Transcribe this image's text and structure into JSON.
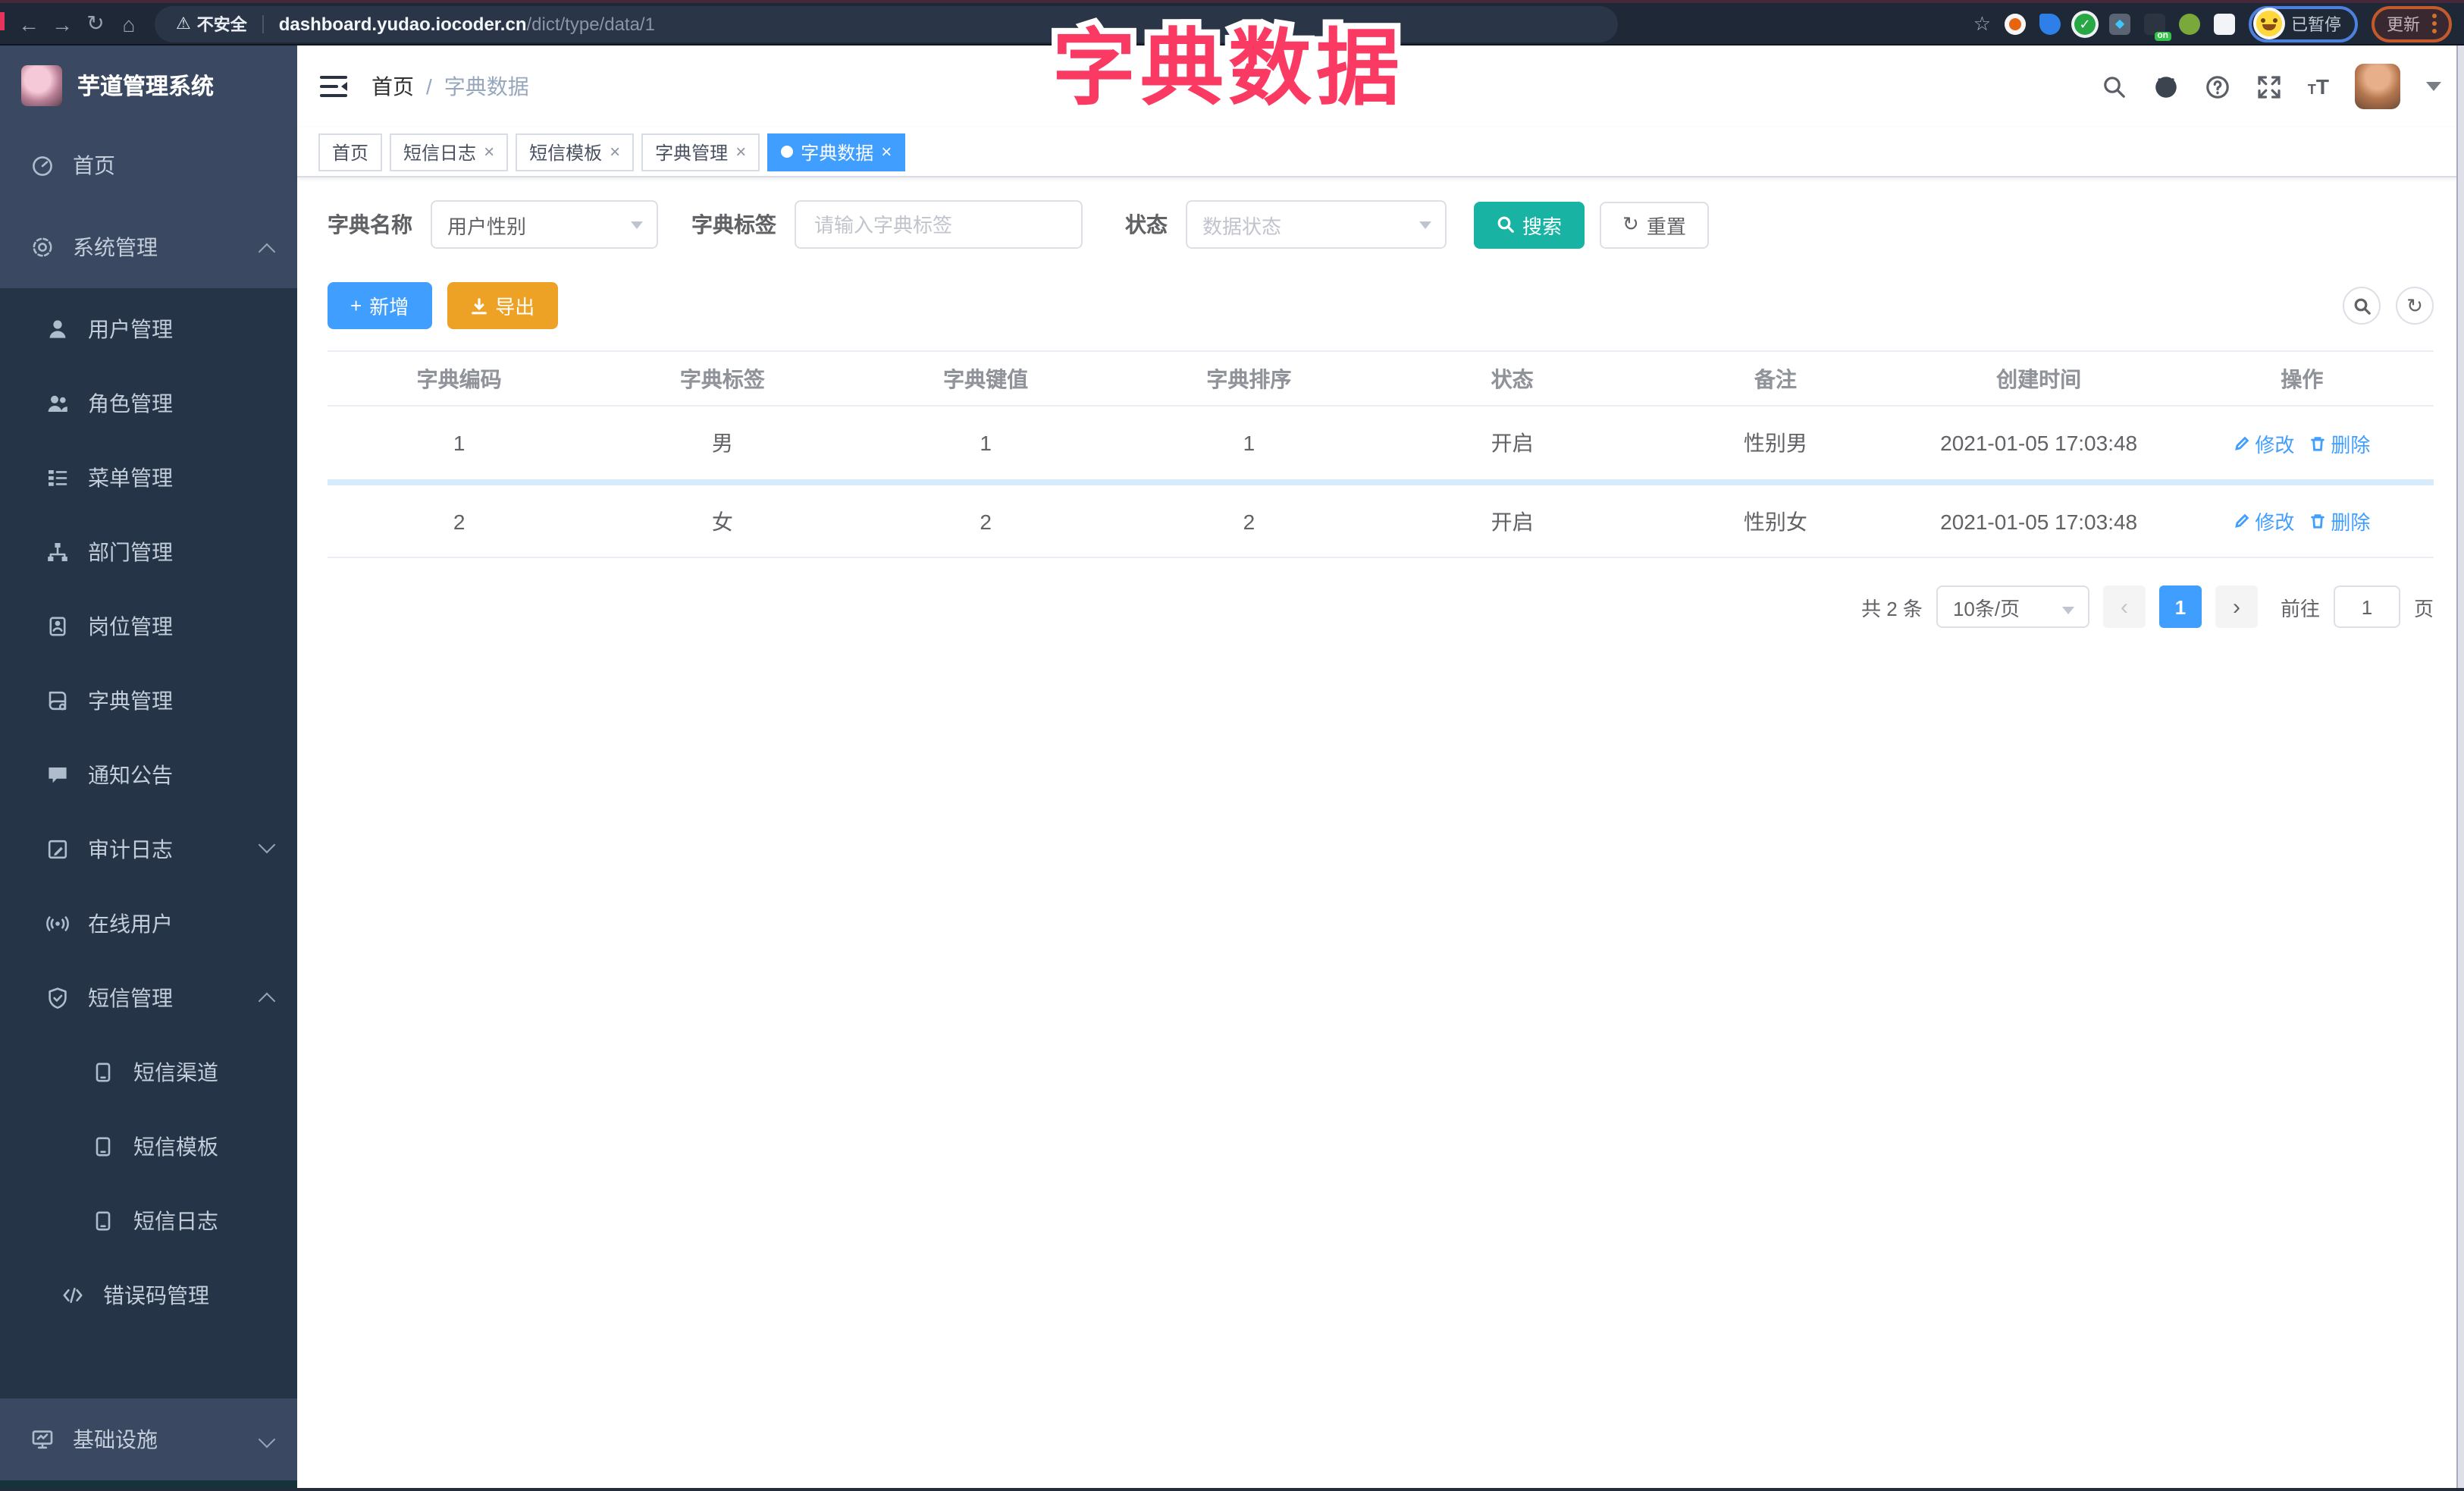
{
  "colors": {
    "primary": "#409eff",
    "search_teal": "#18b3a3",
    "export_warning": "#eda225",
    "overlay_pink": "#fa3a62",
    "sidebar_light": "#3a4961",
    "sidebar_dark": "#253447"
  },
  "overlay": {
    "title": "字典数据"
  },
  "chrome": {
    "security_label": "不安全",
    "url_host": "dashboard.yudao.iocoder.cn",
    "url_path": "/dict/type/data/1",
    "ext_badge": "on",
    "profile_status": "已暂停",
    "update_label": "更新"
  },
  "sidebar": {
    "app_title": "芋道管理系统",
    "items": [
      {
        "label": "首页",
        "icon": "dashboard-icon",
        "level": 1
      },
      {
        "label": "系统管理",
        "icon": "gear-icon",
        "level": 1,
        "expanded": true
      },
      {
        "label": "用户管理",
        "icon": "user-icon",
        "level": 2
      },
      {
        "label": "角色管理",
        "icon": "users-icon",
        "level": 2
      },
      {
        "label": "菜单管理",
        "icon": "menu-list-icon",
        "level": 2
      },
      {
        "label": "部门管理",
        "icon": "org-tree-icon",
        "level": 2
      },
      {
        "label": "岗位管理",
        "icon": "badge-icon",
        "level": 2
      },
      {
        "label": "字典管理",
        "icon": "dict-book-icon",
        "level": 2
      },
      {
        "label": "通知公告",
        "icon": "message-icon",
        "level": 2
      },
      {
        "label": "审计日志",
        "icon": "log-edit-icon",
        "level": 2,
        "expanded": false
      },
      {
        "label": "在线用户",
        "icon": "online-icon",
        "level": 2
      },
      {
        "label": "短信管理",
        "icon": "shield-check-icon",
        "level": 2,
        "expanded": true
      },
      {
        "label": "短信渠道",
        "icon": "phone-icon",
        "level": 3
      },
      {
        "label": "短信模板",
        "icon": "phone-icon",
        "level": 3
      },
      {
        "label": "短信日志",
        "icon": "phone-icon",
        "level": 3
      },
      {
        "label": "错误码管理",
        "icon": "code-icon",
        "level": 2
      },
      {
        "label": "基础设施",
        "icon": "monitor-icon",
        "level": 1,
        "expanded": false
      }
    ]
  },
  "navbar": {
    "breadcrumb_home": "首页",
    "breadcrumb_sep": "/",
    "breadcrumb_current": "字典数据"
  },
  "tabs": [
    {
      "label": "首页",
      "closable": false,
      "active": false
    },
    {
      "label": "短信日志",
      "closable": true,
      "active": false
    },
    {
      "label": "短信模板",
      "closable": true,
      "active": false
    },
    {
      "label": "字典管理",
      "closable": true,
      "active": false
    },
    {
      "label": "字典数据",
      "closable": true,
      "active": true
    }
  ],
  "filters": {
    "name_label": "字典名称",
    "name_value": "用户性别",
    "tag_label": "字典标签",
    "tag_placeholder": "请输入字典标签",
    "status_label": "状态",
    "status_placeholder": "数据状态",
    "search_label": "搜索",
    "reset_label": "重置"
  },
  "toolbar": {
    "add_label": "新增",
    "export_label": "导出"
  },
  "table": {
    "headers": [
      "字典编码",
      "字典标签",
      "字典键值",
      "字典排序",
      "状态",
      "备注",
      "创建时间",
      "操作"
    ],
    "edit_label": "修改",
    "delete_label": "删除",
    "rows": [
      {
        "code": "1",
        "label": "男",
        "value": "1",
        "sort": "1",
        "status": "开启",
        "remark": "性别男",
        "created": "2021-01-05 17:03:48"
      },
      {
        "code": "2",
        "label": "女",
        "value": "2",
        "sort": "2",
        "status": "开启",
        "remark": "性别女",
        "created": "2021-01-05 17:03:48"
      }
    ]
  },
  "pagination": {
    "total": "共 2 条",
    "page_size": "10条/页",
    "prev": "‹",
    "current_page": "1",
    "next": "›",
    "goto_label": "前往",
    "goto_value": "1",
    "unit_label": "页"
  }
}
